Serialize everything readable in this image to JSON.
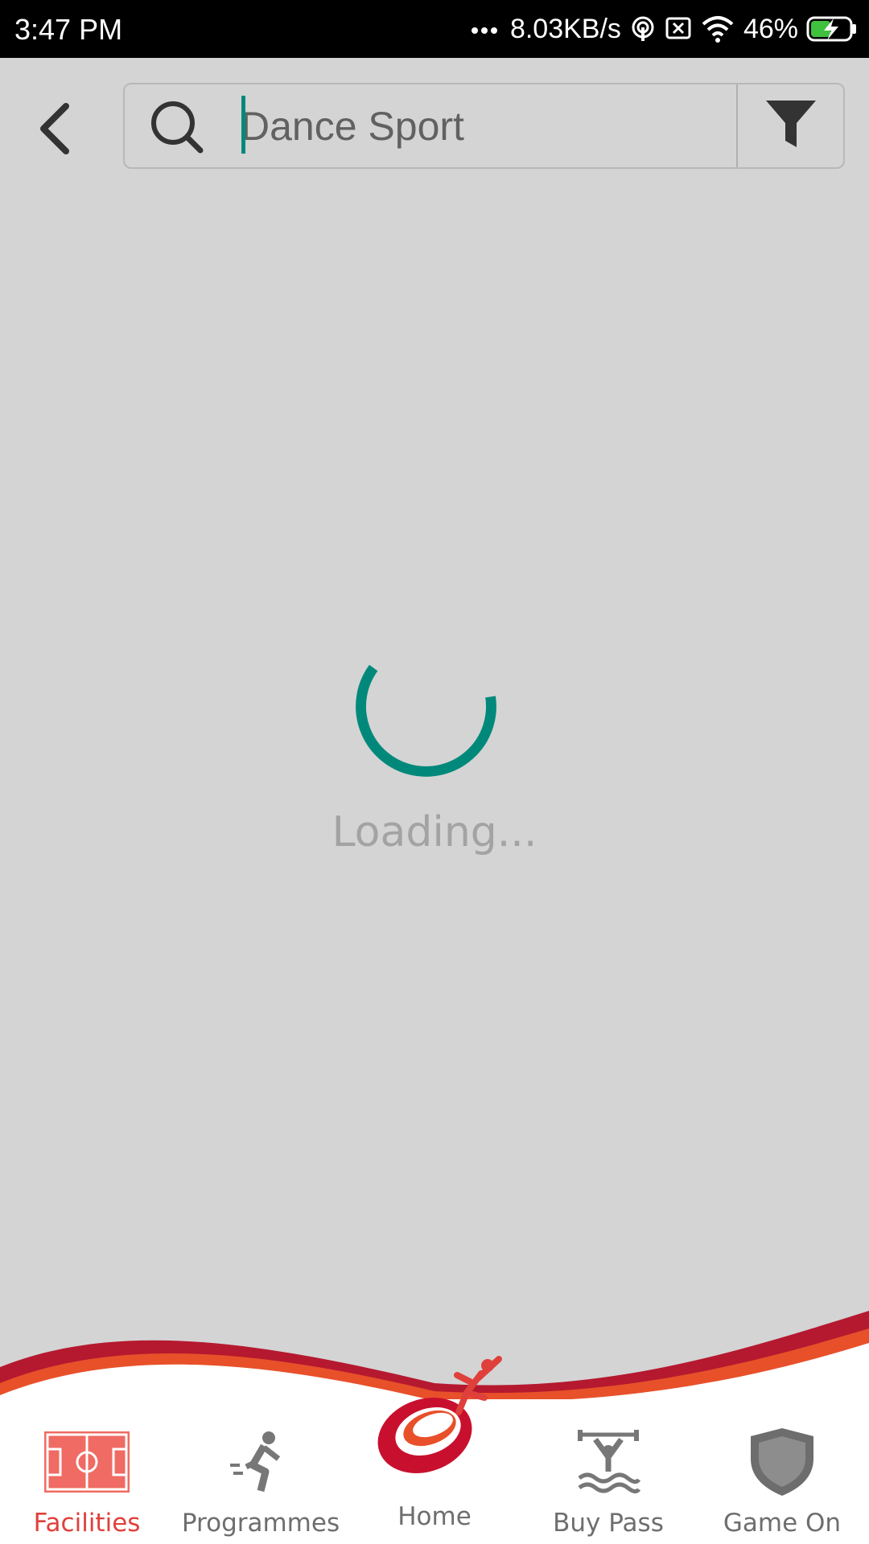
{
  "status_bar": {
    "time": "3:47 PM",
    "network_speed": "8.03KB/s",
    "battery": "46%",
    "icons": [
      "more-dots-icon",
      "hotspot-icon",
      "sim-off-icon",
      "wifi-icon",
      "battery-charging-icon"
    ]
  },
  "search": {
    "value": "Dance Sport",
    "back_icon": "back-arrow-icon",
    "search_icon": "search-icon",
    "filter_icon": "filter-icon"
  },
  "loading": {
    "text": "Loading..."
  },
  "colors": {
    "accent": "#00897b",
    "active_tab": "#e0403b",
    "background": "#d4d4d4",
    "wave_dark_red": "#b5192f",
    "wave_orange": "#e8502a"
  },
  "bottom_nav": {
    "items": [
      {
        "label": "Facilities",
        "icon": "field-icon",
        "active": true
      },
      {
        "label": "Programmes",
        "icon": "runner-icon",
        "active": false
      },
      {
        "label": "Home",
        "icon": "home-logo-icon",
        "active": false
      },
      {
        "label": "Buy Pass",
        "icon": "swimming-icon",
        "active": false
      },
      {
        "label": "Game On",
        "icon": "shield-icon",
        "active": false
      }
    ]
  }
}
